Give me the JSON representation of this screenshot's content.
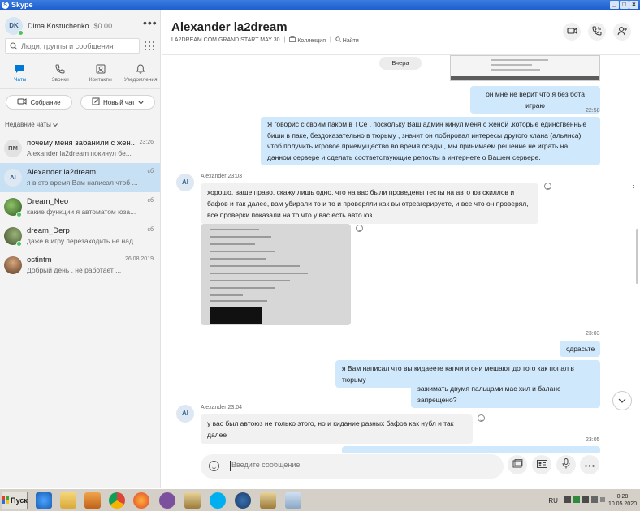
{
  "window": {
    "title": "Skype",
    "controls": [
      "_",
      "□",
      "×"
    ]
  },
  "profile": {
    "initials": "DK",
    "name": "Dima Kostuchenko",
    "balance": "$0.00"
  },
  "search": {
    "placeholder": "Люди, группы и сообщения"
  },
  "nav": {
    "chats": "Чаты",
    "calls": "Звонки",
    "contacts": "Контакты",
    "notifications": "Уведомления"
  },
  "actions": {
    "meeting": "Собрание",
    "new_chat": "Новый чат"
  },
  "recent_title": "Недавние чаты",
  "chats": [
    {
      "name": "почему меня забанили с жен...",
      "preview": "Alexander la2dream покинул бе...",
      "date": "23:26",
      "initials": "ПМ",
      "avatar_bg": "#e2e2e2",
      "avatar_fg": "#555555"
    },
    {
      "name": "Alexander la2dream",
      "preview": "я в это время Вам написал чтоб ...",
      "date": "сб",
      "initials": "AI",
      "avatar_bg": "#dde8f3",
      "avatar_fg": "#2b5f8a"
    },
    {
      "name": "Dream_Neo",
      "preview": "какие функции я автоматом юза...",
      "date": "сб",
      "initials": "",
      "avatar_bg": "#3b6d2a",
      "avatar_fg": "#ffffff"
    },
    {
      "name": "dream_Derp",
      "preview": "даже в игру перезаходить не над...",
      "date": "сб",
      "initials": "",
      "avatar_bg": "#4e6b3b",
      "avatar_fg": "#ffffff"
    },
    {
      "name": "ostintm",
      "preview": "Добрый день , не работает ...",
      "date": "26.08.2019",
      "initials": "",
      "avatar_bg": "#6b4a34",
      "avatar_fg": "#ffffff"
    }
  ],
  "conversation": {
    "title": "Alexander la2dream",
    "subtitle": "LA2DREAM.COM GRAND START MAY 30",
    "gallery": "Коллекция",
    "find": "Найти",
    "day_chip": "Вчера",
    "messages": {
      "m1": "он мне не верит что я без бота играю",
      "t1": "22:58",
      "m2": "Я говорис с своим паком в ТСе , поскольку Ваш админ кинул меня с женой ,которые единственные биши в паке, бездоказательно в тюрьму , значит он лобировал интересы другого клана (альянса) чтоб получить игровое приемущество во время осады , мы принимаем решение не играть на данном сервере и сделать соответствующие репосты в интернете о Вашем сервере.",
      "sender1": "Alexander 23:03",
      "in1": "хорошо, ваше право, скажу лишь одно, что на вас были проведены тесты на авто юз скиллов и бафов и так далее, вам убирали то и то и проверяли как вы отреагерируете, и все что он проверял, все проверки показали на то что у вас есть авто юз",
      "t2": "23:03",
      "m3": "сдрасьте",
      "m4": "я Вам написал что вы кидаеете капчи и они мешают до того как попал в тюрьму",
      "m5": "зажимать двумя пальцами мас хил и баланс запрещено?",
      "sender2": "Alexander 23:04",
      "in2": "у вас был автоюз не только этого, но и кидание разных бафов как нубл и так далее",
      "t3": "23:05",
      "avatar": "AI"
    }
  },
  "composer": {
    "placeholder": "Введите сообщение"
  },
  "taskbar": {
    "start": "Пуск",
    "lang": "RU",
    "time": "0:28",
    "date": "10.05.2020"
  },
  "colors": {
    "accent": "#0078d4",
    "outgoing": "#d0e8fb",
    "incoming": "#f1f1f1",
    "online": "#49c45a"
  }
}
